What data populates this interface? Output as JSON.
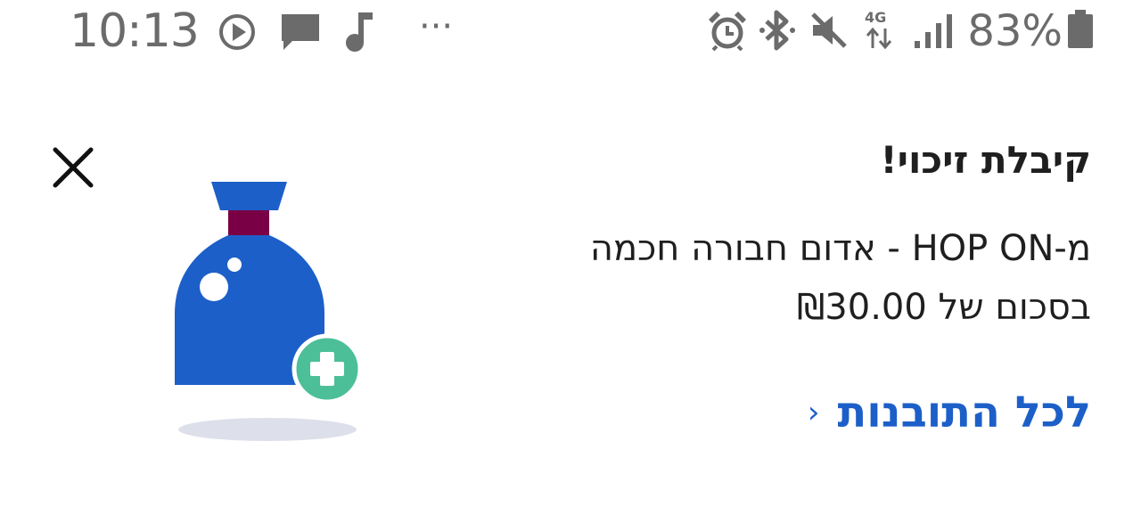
{
  "status_bar": {
    "time": "10:13",
    "network_label": "4G",
    "battery_percent": "83%",
    "more": "···",
    "icons": [
      "play-icon",
      "message-icon",
      "music-note-icon",
      "alarm-icon",
      "bluetooth-icon",
      "mute-icon",
      "signal-icon",
      "battery-icon"
    ],
    "color": "#6b6b6b"
  },
  "notification": {
    "title": "קיבלת זיכוי!",
    "description_line1": "מ-HOP ON - אדום חבורה חכמה",
    "description_line2": "בסכום של ₪30.00",
    "link_label": "לכל התובנות",
    "link_chevron": "‹",
    "close_icon": "close-icon",
    "illustration": "money-bag-plus-icon",
    "colors": {
      "link": "#1d5fc8",
      "bag": "#1d5fc8",
      "bag_neck": "#7a0046",
      "plus_badge": "#4cbf98",
      "shadow": "#dde0ea"
    }
  }
}
